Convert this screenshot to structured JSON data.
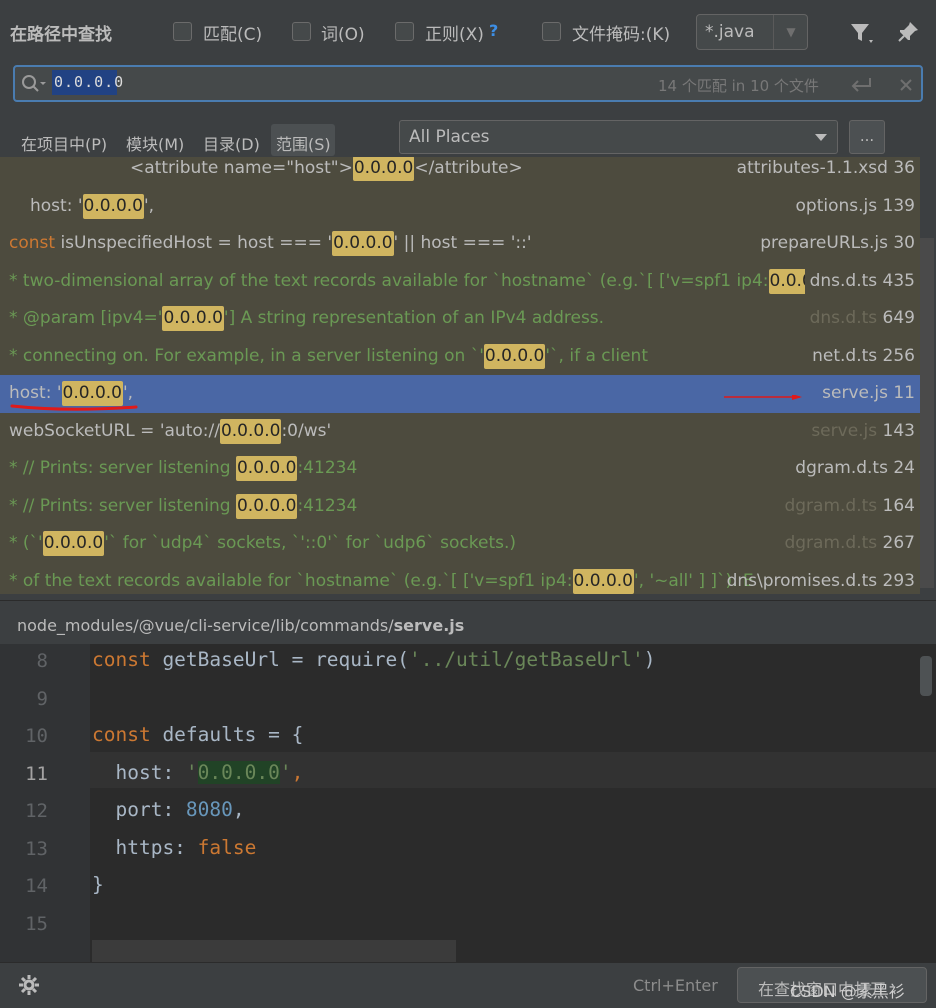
{
  "header": {
    "title": "在路径中查找",
    "options": [
      {
        "label": "匹配(C)"
      },
      {
        "label": "词(O)"
      },
      {
        "label": "正则(X)"
      },
      {
        "label": "文件掩码:(K)"
      }
    ],
    "help": "?",
    "file_mask": "*.java"
  },
  "search": {
    "query": "0.0.0.0",
    "match_info": "14 个匹配 in 10 个文件"
  },
  "scope": {
    "tabs": [
      {
        "label": "在项目中(P)"
      },
      {
        "label": "模块(M)"
      },
      {
        "label": "目录(D)"
      },
      {
        "label": "范围(S)"
      }
    ],
    "selected": "All Places",
    "more": "..."
  },
  "results": [
    {
      "pre": "<attribute name=\"host\">",
      "hl": "0.0.0.0",
      "post": "</attribute>",
      "file": "attributes-1.1.xsd",
      "line": "36"
    },
    {
      "pre": "host: '",
      "hl": "0.0.0.0",
      "post": "',",
      "file": "options.js",
      "line": "139"
    },
    {
      "kw": "const",
      "pre": " isUnspecifiedHost = host === '",
      "hl": "0.0.0.0",
      "post": "' || host === '::'",
      "file": "prepareURLs.js",
      "line": "30"
    },
    {
      "pre": "* two-dimensional array of the text records available for `hostname` (e.g.`[ ['v=spf1 ip4:",
      "hl": "0.0.0.0",
      "post": "",
      "file": "dns.d.ts",
      "line": "435"
    },
    {
      "pre": "* @param [ipv4='",
      "hl": "0.0.0.0",
      "post": "'] A string representation of an IPv4 address.",
      "file": "dns.d.ts",
      "line": "649"
    },
    {
      "pre": "* connecting on. For example, in a server listening on `'",
      "hl": "0.0.0.0",
      "post": "'`, if a client",
      "file": "net.d.ts",
      "line": "256"
    },
    {
      "pre": "host: '",
      "hl": "0.0.0.0",
      "post": "',",
      "file": "serve.js",
      "line": "11"
    },
    {
      "pre": "webSocketURL = 'auto://",
      "hl": "0.0.0.0",
      "post": ":0/ws'",
      "file": "serve.js",
      "line": "143"
    },
    {
      "pre": "* // Prints: server listening ",
      "hl": "0.0.0.0",
      "post": ":41234",
      "file": "dgram.d.ts",
      "line": "24"
    },
    {
      "pre": "* // Prints: server listening ",
      "hl": "0.0.0.0",
      "post": ":41234",
      "file": "dgram.d.ts",
      "line": "164"
    },
    {
      "pre": "* (`'",
      "hl": "0.0.0.0",
      "post": "'` for `udp4` sockets, `'::0'` for `udp6` sockets.)",
      "file": "dgram.d.ts",
      "line": "267"
    },
    {
      "pre": "* of the text records available for `hostname` (e.g.`[ ['v=spf1 ip4:",
      "hl": "0.0.0.0",
      "post": "', '~all' ] ]`). E",
      "file": "dns\\promises.d.ts",
      "line": "293"
    }
  ],
  "preview": {
    "path_prefix": "node_modules/@vue/cli-service/lib/commands/",
    "path_file": "serve.js",
    "lines": [
      {
        "n": "8",
        "a": "const",
        "b": " getBaseUrl = require(",
        "c": "'../util/getBaseUrl'",
        "d": ")"
      },
      {
        "n": "9",
        "a": "",
        "b": "",
        "c": "",
        "d": ""
      },
      {
        "n": "10",
        "a": "const",
        "b": " defaults = {",
        "c": "",
        "d": ""
      },
      {
        "n": "11",
        "a": "",
        "b": "  host: ",
        "c": "'0.0.0.0'",
        "d": ","
      },
      {
        "n": "12",
        "a": "",
        "b": "  port: ",
        "c": "8080",
        "d": ","
      },
      {
        "n": "13",
        "a": "",
        "b": "  https: ",
        "c": "false",
        "d": ""
      },
      {
        "n": "14",
        "a": "",
        "b": "}",
        "c": "",
        "d": ""
      },
      {
        "n": "15",
        "a": "",
        "b": "",
        "c": "",
        "d": ""
      }
    ]
  },
  "footer": {
    "shortcut": "Ctrl+Enter",
    "open_button": "在查找窗口中打开",
    "watermark": "CSDN @素黑衫"
  }
}
